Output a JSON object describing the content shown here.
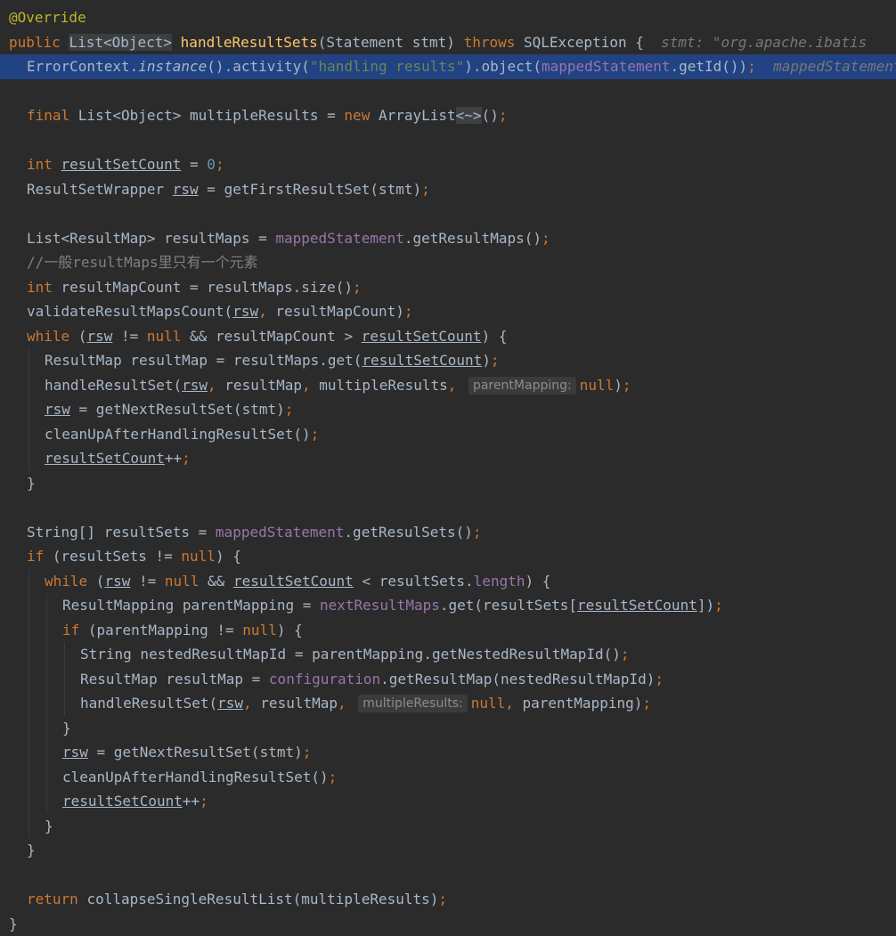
{
  "editor": {
    "language": "java",
    "theme_colors": {
      "background": "#2b2b2b",
      "current_line": "#214283",
      "keyword": "#cc7832",
      "annotation": "#bbb529",
      "string": "#6a8759",
      "number": "#6897bb",
      "field": "#9876aa",
      "method": "#ffc66d",
      "comment": "#808080",
      "plain": "#a9b7c6"
    },
    "current_line_index": 2,
    "lines": [
      {
        "indent": 0,
        "tokens": [
          {
            "t": "@Override",
            "c": "ann"
          }
        ]
      },
      {
        "indent": 0,
        "tokens": [
          {
            "t": "public ",
            "c": "kw"
          },
          {
            "t": "List<Object>",
            "c": "pl boxed"
          },
          {
            "t": " ",
            "c": "pl"
          },
          {
            "t": "handleResultSets",
            "c": "fn"
          },
          {
            "t": "(Statement stmt) ",
            "c": "pl"
          },
          {
            "t": "throws ",
            "c": "kw"
          },
          {
            "t": "SQLException {  ",
            "c": "pl"
          },
          {
            "t": "stmt: \"org.apache.ibatis",
            "c": "hint-inline"
          }
        ]
      },
      {
        "indent": 1,
        "tokens": [
          {
            "t": "ErrorContext.",
            "c": "pl"
          },
          {
            "t": "instance",
            "c": "pl it"
          },
          {
            "t": "().activity(",
            "c": "pl"
          },
          {
            "t": "\"handling results\"",
            "c": "str"
          },
          {
            "t": ").object(",
            "c": "pl"
          },
          {
            "t": "mappedStatement",
            "c": "fld"
          },
          {
            "t": ".getId())",
            "c": "pl"
          },
          {
            "t": ";",
            "c": "kw"
          },
          {
            "t": "  mappedStatement",
            "c": "hint-inline"
          }
        ]
      },
      {
        "indent": 0,
        "tokens": []
      },
      {
        "indent": 1,
        "tokens": [
          {
            "t": "final ",
            "c": "kw"
          },
          {
            "t": "List<Object> multipleResults = ",
            "c": "pl"
          },
          {
            "t": "new ",
            "c": "kw"
          },
          {
            "t": "ArrayList",
            "c": "pl"
          },
          {
            "t": "<~>",
            "c": "diamond"
          },
          {
            "t": "()",
            "c": "pl"
          },
          {
            "t": ";",
            "c": "kw"
          }
        ]
      },
      {
        "indent": 0,
        "tokens": []
      },
      {
        "indent": 1,
        "tokens": [
          {
            "t": "int ",
            "c": "kw"
          },
          {
            "t": "resultSetCount",
            "c": "pl ul"
          },
          {
            "t": " = ",
            "c": "pl"
          },
          {
            "t": "0",
            "c": "num"
          },
          {
            "t": ";",
            "c": "kw"
          }
        ]
      },
      {
        "indent": 1,
        "tokens": [
          {
            "t": "ResultSetWrapper ",
            "c": "pl"
          },
          {
            "t": "rsw",
            "c": "pl ul"
          },
          {
            "t": " = getFirstResultSet(stmt)",
            "c": "pl"
          },
          {
            "t": ";",
            "c": "kw"
          }
        ]
      },
      {
        "indent": 0,
        "tokens": []
      },
      {
        "indent": 1,
        "tokens": [
          {
            "t": "List<ResultMap> resultMaps = ",
            "c": "pl"
          },
          {
            "t": "mappedStatement",
            "c": "fld"
          },
          {
            "t": ".getResultMaps()",
            "c": "pl"
          },
          {
            "t": ";",
            "c": "kw"
          }
        ]
      },
      {
        "indent": 1,
        "tokens": [
          {
            "t": "//一般resultMaps里只有一个元素",
            "c": "cm"
          }
        ]
      },
      {
        "indent": 1,
        "tokens": [
          {
            "t": "int ",
            "c": "kw"
          },
          {
            "t": "resultMapCount = resultMaps.size()",
            "c": "pl"
          },
          {
            "t": ";",
            "c": "kw"
          }
        ]
      },
      {
        "indent": 1,
        "tokens": [
          {
            "t": "validateResultMapsCount(",
            "c": "pl"
          },
          {
            "t": "rsw",
            "c": "pl ul"
          },
          {
            "t": ", ",
            "c": "kw"
          },
          {
            "t": "resultMapCount)",
            "c": "pl"
          },
          {
            "t": ";",
            "c": "kw"
          }
        ]
      },
      {
        "indent": 1,
        "tokens": [
          {
            "t": "while ",
            "c": "kw"
          },
          {
            "t": "(",
            "c": "pl"
          },
          {
            "t": "rsw",
            "c": "pl ul"
          },
          {
            "t": " != ",
            "c": "pl"
          },
          {
            "t": "null ",
            "c": "kw"
          },
          {
            "t": "&& resultMapCount > ",
            "c": "pl"
          },
          {
            "t": "resultSetCount",
            "c": "pl ul"
          },
          {
            "t": ") {",
            "c": "pl"
          }
        ]
      },
      {
        "indent": 2,
        "tokens": [
          {
            "t": "ResultMap resultMap = resultMaps.get(",
            "c": "pl"
          },
          {
            "t": "resultSetCount",
            "c": "pl ul"
          },
          {
            "t": ")",
            "c": "pl"
          },
          {
            "t": ";",
            "c": "kw"
          }
        ]
      },
      {
        "indent": 2,
        "tokens": [
          {
            "t": "handleResultSet(",
            "c": "pl"
          },
          {
            "t": "rsw",
            "c": "pl ul"
          },
          {
            "t": ", ",
            "c": "kw"
          },
          {
            "t": "resultMap",
            "c": "pl"
          },
          {
            "t": ", ",
            "c": "kw"
          },
          {
            "t": "multipleResults",
            "c": "pl"
          },
          {
            "t": ", ",
            "c": "kw"
          },
          {
            "t": "parentMapping:",
            "c": "param-hint"
          },
          {
            "t": "null",
            "c": "kw"
          },
          {
            "t": ")",
            "c": "pl"
          },
          {
            "t": ";",
            "c": "kw"
          }
        ]
      },
      {
        "indent": 2,
        "tokens": [
          {
            "t": "rsw",
            "c": "pl ul"
          },
          {
            "t": " = getNextResultSet(stmt)",
            "c": "pl"
          },
          {
            "t": ";",
            "c": "kw"
          }
        ]
      },
      {
        "indent": 2,
        "tokens": [
          {
            "t": "cleanUpAfterHandlingResultSet()",
            "c": "pl"
          },
          {
            "t": ";",
            "c": "kw"
          }
        ]
      },
      {
        "indent": 2,
        "tokens": [
          {
            "t": "resultSetCount",
            "c": "pl ul"
          },
          {
            "t": "++",
            "c": "pl"
          },
          {
            "t": ";",
            "c": "kw"
          }
        ]
      },
      {
        "indent": 1,
        "tokens": [
          {
            "t": "}",
            "c": "pl"
          }
        ]
      },
      {
        "indent": 0,
        "tokens": []
      },
      {
        "indent": 1,
        "tokens": [
          {
            "t": "String[] resultSets = ",
            "c": "pl"
          },
          {
            "t": "mappedStatement",
            "c": "fld"
          },
          {
            "t": ".getResulSets()",
            "c": "pl"
          },
          {
            "t": ";",
            "c": "kw"
          }
        ]
      },
      {
        "indent": 1,
        "tokens": [
          {
            "t": "if ",
            "c": "kw"
          },
          {
            "t": "(resultSets != ",
            "c": "pl"
          },
          {
            "t": "null",
            "c": "kw"
          },
          {
            "t": ") {",
            "c": "pl"
          }
        ]
      },
      {
        "indent": 2,
        "tokens": [
          {
            "t": "while ",
            "c": "kw"
          },
          {
            "t": "(",
            "c": "pl"
          },
          {
            "t": "rsw",
            "c": "pl ul"
          },
          {
            "t": " != ",
            "c": "pl"
          },
          {
            "t": "null ",
            "c": "kw"
          },
          {
            "t": "&& ",
            "c": "pl"
          },
          {
            "t": "resultSetCount",
            "c": "pl ul"
          },
          {
            "t": " < resultSets.",
            "c": "pl"
          },
          {
            "t": "length",
            "c": "fld"
          },
          {
            "t": ") {",
            "c": "pl"
          }
        ]
      },
      {
        "indent": 3,
        "tokens": [
          {
            "t": "ResultMapping parentMapping = ",
            "c": "pl"
          },
          {
            "t": "nextResultMaps",
            "c": "fld"
          },
          {
            "t": ".get(resultSets[",
            "c": "pl"
          },
          {
            "t": "resultSetCount",
            "c": "pl ul"
          },
          {
            "t": "])",
            "c": "pl"
          },
          {
            "t": ";",
            "c": "kw"
          }
        ]
      },
      {
        "indent": 3,
        "tokens": [
          {
            "t": "if ",
            "c": "kw"
          },
          {
            "t": "(parentMapping != ",
            "c": "pl"
          },
          {
            "t": "null",
            "c": "kw"
          },
          {
            "t": ") {",
            "c": "pl"
          }
        ]
      },
      {
        "indent": 4,
        "tokens": [
          {
            "t": "String nestedResultMapId = parentMapping.getNestedResultMapId()",
            "c": "pl"
          },
          {
            "t": ";",
            "c": "kw"
          }
        ]
      },
      {
        "indent": 4,
        "tokens": [
          {
            "t": "ResultMap resultMap = ",
            "c": "pl"
          },
          {
            "t": "configuration",
            "c": "fld"
          },
          {
            "t": ".getResultMap(nestedResultMapId)",
            "c": "pl"
          },
          {
            "t": ";",
            "c": "kw"
          }
        ]
      },
      {
        "indent": 4,
        "tokens": [
          {
            "t": "handleResultSet(",
            "c": "pl"
          },
          {
            "t": "rsw",
            "c": "pl ul"
          },
          {
            "t": ", ",
            "c": "kw"
          },
          {
            "t": "resultMap",
            "c": "pl"
          },
          {
            "t": ", ",
            "c": "kw"
          },
          {
            "t": "multipleResults:",
            "c": "param-hint"
          },
          {
            "t": "null",
            "c": "kw"
          },
          {
            "t": ", ",
            "c": "kw"
          },
          {
            "t": "parentMapping)",
            "c": "pl"
          },
          {
            "t": ";",
            "c": "kw"
          }
        ]
      },
      {
        "indent": 3,
        "tokens": [
          {
            "t": "}",
            "c": "pl"
          }
        ]
      },
      {
        "indent": 3,
        "tokens": [
          {
            "t": "rsw",
            "c": "pl ul"
          },
          {
            "t": " = getNextResultSet(stmt)",
            "c": "pl"
          },
          {
            "t": ";",
            "c": "kw"
          }
        ]
      },
      {
        "indent": 3,
        "tokens": [
          {
            "t": "cleanUpAfterHandlingResultSet()",
            "c": "pl"
          },
          {
            "t": ";",
            "c": "kw"
          }
        ]
      },
      {
        "indent": 3,
        "tokens": [
          {
            "t": "resultSetCount",
            "c": "pl ul"
          },
          {
            "t": "++",
            "c": "pl"
          },
          {
            "t": ";",
            "c": "kw"
          }
        ]
      },
      {
        "indent": 2,
        "tokens": [
          {
            "t": "}",
            "c": "pl"
          }
        ]
      },
      {
        "indent": 1,
        "tokens": [
          {
            "t": "}",
            "c": "pl"
          }
        ]
      },
      {
        "indent": 0,
        "tokens": []
      },
      {
        "indent": 1,
        "tokens": [
          {
            "t": "return ",
            "c": "kw"
          },
          {
            "t": "collapseSingleResultList(multipleResults)",
            "c": "pl"
          },
          {
            "t": ";",
            "c": "kw"
          }
        ]
      },
      {
        "indent": 0,
        "tokens": [
          {
            "t": "}",
            "c": "pl"
          }
        ]
      }
    ]
  }
}
